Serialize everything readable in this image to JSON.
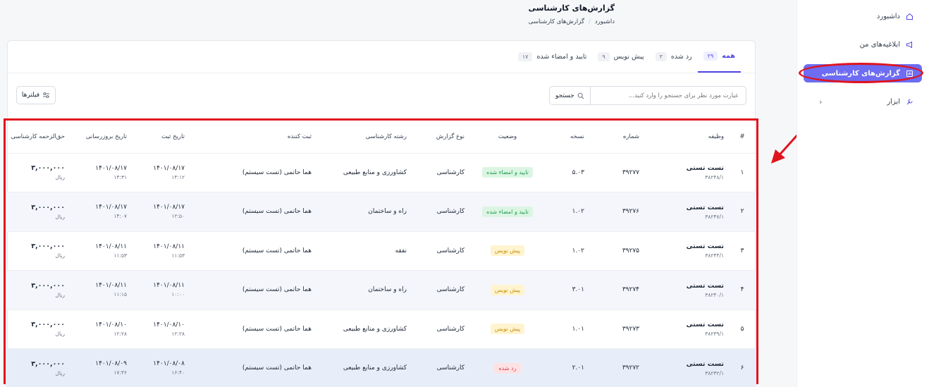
{
  "sidebar": {
    "items": [
      {
        "label": "داشبورد",
        "icon": "home-icon"
      },
      {
        "label": "ابلاغیه‌های من",
        "icon": "megaphone-icon"
      },
      {
        "label": "گزارش‌های کارشناسی",
        "icon": "report-icon",
        "active": true
      },
      {
        "label": "ابزار",
        "icon": "tools-icon",
        "has_submenu": true
      }
    ]
  },
  "header": {
    "title": "گزارش‌های کارشناسی",
    "breadcrumb": [
      "داشبورد",
      "گزارش‌های کارشناسی"
    ]
  },
  "tabs": [
    {
      "label": "همه",
      "count": "۲۹",
      "active": true
    },
    {
      "label": "رد شده",
      "count": "۳"
    },
    {
      "label": "پیش نویس",
      "count": "۹"
    },
    {
      "label": "تایید و امضاء شده",
      "count": "۱۷"
    }
  ],
  "search": {
    "placeholder": "عبارت مورد نظر برای جستجو را وارد کنید...",
    "button_label": "جستجو"
  },
  "filters": {
    "label": "فیلترها"
  },
  "table": {
    "headers": [
      "#",
      "وظیفه",
      "شماره",
      "نسخه",
      "وضعیت",
      "نوع گزارش",
      "رشته کارشناسی",
      "ثبت کننده",
      "تاریخ ثبت",
      "تاریخ بروزرسانی",
      "حق‌الزحمه کارشناسی"
    ],
    "rows": [
      {
        "idx": "۱",
        "task": "تست تستی",
        "task_code": "۳۸۲۴۸/۱",
        "number": "۳۹۲۷۷",
        "version": "۵.۰۳",
        "status": "تایید و امضاء شده",
        "status_color": "green",
        "type": "کارشناسی",
        "field": "کشاورزی و منابع طبیعی",
        "registrar": "هما حاتمی (تست سیستم)",
        "reg_date": "۱۴۰۱/۰۸/۱۷",
        "reg_time": "۱۴:۱۲",
        "upd_date": "۱۴۰۱/۰۸/۱۷",
        "upd_time": "۱۴:۳۱",
        "fee": "۳,۰۰۰,۰۰۰",
        "currency": "ریال"
      },
      {
        "idx": "۲",
        "task": "تست تستی",
        "task_code": "۳۸۲۴۷/۱",
        "number": "۳۹۲۷۶",
        "version": "۱.۰۲",
        "status": "تایید و امضاء شده",
        "status_color": "green",
        "type": "کارشناسی",
        "field": "راه و ساختمان",
        "registrar": "هما حاتمی (تست سیستم)",
        "reg_date": "۱۴۰۱/۰۸/۱۷",
        "reg_time": "۱۲:۵۰",
        "upd_date": "۱۴۰۱/۰۸/۱۷",
        "upd_time": "۱۴:۰۷",
        "fee": "۳,۰۰۰,۰۰۰",
        "currency": "ریال"
      },
      {
        "idx": "۳",
        "task": "تست تستی",
        "task_code": "۳۸۲۴۴/۱",
        "number": "۳۹۲۷۵",
        "version": "۱.۰۲",
        "status": "پیش نویس",
        "status_color": "yellow",
        "type": "کارشناسی",
        "field": "نفقه",
        "registrar": "هما حاتمی (تست سیستم)",
        "reg_date": "۱۴۰۱/۰۸/۱۱",
        "reg_time": "۱۱:۵۳",
        "upd_date": "۱۴۰۱/۰۸/۱۱",
        "upd_time": "۱۱:۵۳",
        "fee": "۳,۰۰۰,۰۰۰",
        "currency": "ریال"
      },
      {
        "idx": "۴",
        "task": "تست تستی",
        "task_code": "۳۸۲۴۰/۱",
        "number": "۳۹۲۷۴",
        "version": "۳.۰۱",
        "status": "پیش نویس",
        "status_color": "yellow",
        "type": "کارشناسی",
        "field": "راه و ساختمان",
        "registrar": "هما حاتمی (تست سیستم)",
        "reg_date": "۱۴۰۱/۰۸/۱۱",
        "reg_time": "۱۰:۰۰",
        "upd_date": "۱۴۰۱/۰۸/۱۱",
        "upd_time": "۱۱:۱۵",
        "fee": "۳,۰۰۰,۰۰۰",
        "currency": "ریال"
      },
      {
        "idx": "۵",
        "task": "تست تستی",
        "task_code": "۳۸۲۳۹/۱",
        "number": "۳۹۲۷۳",
        "version": "۱.۰۱",
        "status": "پیش نویس",
        "status_color": "yellow",
        "type": "کارشناسی",
        "field": "کشاورزی و منابع طبیعی",
        "registrar": "هما حاتمی (تست سیستم)",
        "reg_date": "۱۴۰۱/۰۸/۱۰",
        "reg_time": "۱۲:۲۸",
        "upd_date": "۱۴۰۱/۰۸/۱۰",
        "upd_time": "۱۲:۲۸",
        "fee": "۳,۰۰۰,۰۰۰",
        "currency": "ریال"
      },
      {
        "idx": "۶",
        "task": "تست تستی",
        "task_code": "۳۸۲۳۲/۱",
        "number": "۳۹۲۷۲",
        "version": "۲.۰۱",
        "status": "رد شده",
        "status_color": "red",
        "type": "کارشناسی",
        "field": "کشاورزی و منابع طبیعی",
        "registrar": "هما حاتمی (تست سیستم)",
        "reg_date": "۱۴۰۱/۰۸/۰۸",
        "reg_time": "۱۶:۴۰",
        "upd_date": "۱۴۰۱/۰۸/۰۹",
        "upd_time": "۱۷:۳۶",
        "fee": "۳,۰۰۰,۰۰۰",
        "currency": "ریال"
      }
    ]
  },
  "colors": {
    "accent": "#6d6cf2",
    "annotation_red": "#e0141e"
  }
}
